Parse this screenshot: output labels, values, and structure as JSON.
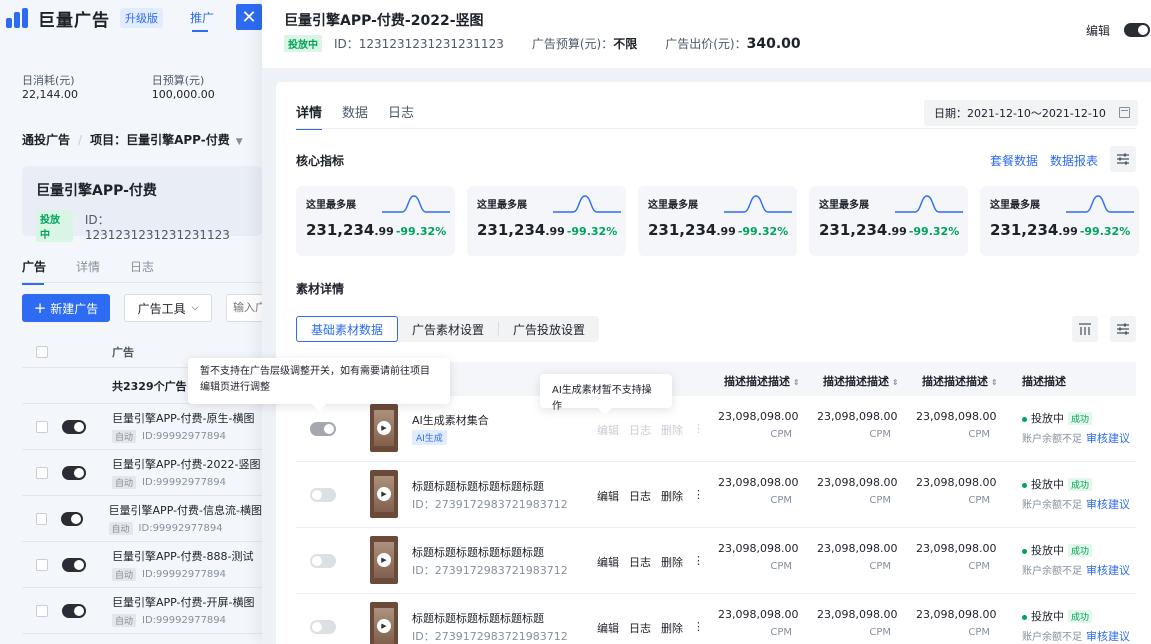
{
  "left": {
    "logo_text": "巨量广告",
    "edition": "升级版",
    "promote": "推广",
    "close_glyph": "✕",
    "daily_spend_label": "日消耗(元)",
    "daily_spend": "22,144.00",
    "daily_budget_label": "日预算(元)",
    "daily_budget": "100,000.00",
    "crumb_root": "通投广告",
    "crumb_sep": "/",
    "crumb_project": "项目：巨量引擎APP-付费",
    "campaign_name": "巨量引擎APP-付费",
    "campaign_status": "投放中",
    "campaign_id": "ID：1231231231231231123",
    "tabs": [
      "广告",
      "详情",
      "日志"
    ],
    "new_ad": "新建广告",
    "ad_tools": "广告工具",
    "search_placeholder": "输入广",
    "col_ad": "广告",
    "total": "共2329个广告",
    "rows": [
      {
        "name": "巨量引擎APP-付费-原生-横图",
        "tag": "自动",
        "id": "ID:99992977894"
      },
      {
        "name": "巨量引擎APP-付费-2022-竖图",
        "tag": "自动",
        "id": "ID:99992977894"
      },
      {
        "name": "巨量引擎APP-付费-信息流-横图",
        "tag": "自动",
        "id": "ID:99992977894"
      },
      {
        "name": "巨量引擎APP-付费-888-测试",
        "tag": "自动",
        "id": "ID:99992977894"
      },
      {
        "name": "巨量引擎APP-付费-开屏-横图",
        "tag": "自动",
        "id": "ID:99992977894"
      }
    ]
  },
  "tooltips": {
    "switch_tip": "暂不支持在广告层级调整开关，如有需要请前往项目编辑页进行调整",
    "ai_tip": "AI生成素材暂不支持操作"
  },
  "drawer": {
    "title": "巨量引擎APP-付费-2022-竖图",
    "status": "投放中",
    "id": "ID：1231231231231231123",
    "budget_label": "广告预算(元)：",
    "budget_value": "不限",
    "bid_label": "广告出价(元)：",
    "bid_value": "340.00",
    "edit_label": "编辑",
    "tabs": [
      "详情",
      "数据",
      "日志"
    ],
    "date_label": "日期：",
    "date_range": "2021-12-10～2021-12-10",
    "core_metrics_title": "核心指标",
    "link_package": "套餐数据",
    "link_report": "数据报表",
    "metrics": [
      {
        "label": "这里最多展",
        "int": "231,234",
        "dec": ".99",
        "change": "-99.32%"
      },
      {
        "label": "这里最多展",
        "int": "231,234",
        "dec": ".99",
        "change": "-99.32%"
      },
      {
        "label": "这里最多展",
        "int": "231,234",
        "dec": ".99",
        "change": "-99.32%"
      },
      {
        "label": "这里最多展",
        "int": "231,234",
        "dec": ".99",
        "change": "-99.32%"
      },
      {
        "label": "这里最多展",
        "int": "231,234",
        "dec": ".99",
        "change": "-99.32%"
      }
    ],
    "material_title": "素材详情",
    "segments": [
      "基础素材数据",
      "广告素材设置",
      "广告投放设置"
    ],
    "columns": [
      "描述描述描述",
      "描述描述描述",
      "描述描述描述",
      "描述描述"
    ],
    "sort_glyph": "⇕",
    "rows": [
      {
        "name": "AI生成素材集合",
        "id": "",
        "ai_tag": "AI生成",
        "actions": [
          "编辑",
          "日志",
          "删除",
          "⋮"
        ],
        "vals": [
          "23,098,098.00",
          "23,098,098.00",
          "23,098,098.00"
        ],
        "unit": "CPM",
        "status": "投放中",
        "success": "成功",
        "note": "账户余额不足",
        "advice": "审核建议"
      },
      {
        "name": "标题标题标题标题标题标题",
        "id": "ID：2739172983721983712",
        "ai_tag": "",
        "actions": [
          "编辑",
          "日志",
          "删除",
          "⋮"
        ],
        "vals": [
          "23,098,098.00",
          "23,098,098.00",
          "23,098,098.00"
        ],
        "unit": "CPM",
        "status": "投放中",
        "success": "成功",
        "note": "账户余额不足",
        "advice": "审核建议"
      },
      {
        "name": "标题标题标题标题标题标题",
        "id": "ID：2739172983721983712",
        "ai_tag": "",
        "actions": [
          "编辑",
          "日志",
          "删除",
          "⋮"
        ],
        "vals": [
          "23,098,098.00",
          "23,098,098.00",
          "23,098,098.00"
        ],
        "unit": "CPM",
        "status": "投放中",
        "success": "成功",
        "note": "账户余额不足",
        "advice": "审核建议"
      },
      {
        "name": "标题标题标题标题标题标题",
        "id": "ID：2739172983721983712",
        "ai_tag": "",
        "actions": [
          "编辑",
          "日志",
          "删除",
          "⋮"
        ],
        "vals": [
          "23,098,098.00",
          "23,098,098.00",
          "23,098,098.00"
        ],
        "unit": "CPM",
        "status": "投放中",
        "success": "成功",
        "note": "账户余额不足",
        "advice": "审核建议"
      }
    ]
  },
  "colors": {
    "brand": "#2c6bf2",
    "success": "#00a35c",
    "text": "#1d2129"
  },
  "icons": [
    "close-icon",
    "plus-icon",
    "chevron-down-icon",
    "calendar-icon",
    "settings-sliders-icon",
    "column-settings-icon",
    "play-icon",
    "more-icon",
    "shield-check-icon"
  ]
}
